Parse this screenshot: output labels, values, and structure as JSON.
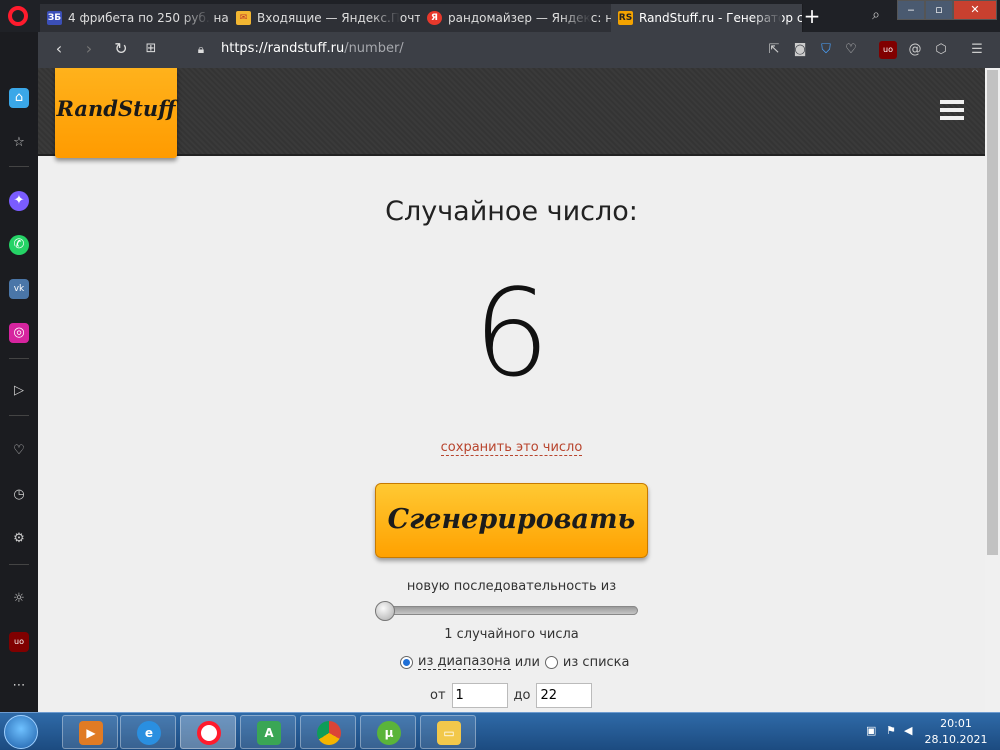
{
  "browser": {
    "tabs": [
      {
        "favicon": "ЗБ",
        "favicon_color": "#3b4fb8",
        "title": "4 фрибета по 250 руб. на"
      },
      {
        "favicon": "✉",
        "favicon_color": "#f2b632",
        "title": "Входящие — Яндекс.Почт"
      },
      {
        "favicon": "Я",
        "favicon_color": "#e8392c",
        "title": "рандомайзер — Яндекс: н"
      },
      {
        "favicon": "RS",
        "favicon_color": "#f4a300",
        "title": "RandStuff.ru - Генератор с"
      }
    ],
    "new_tab_label": "+",
    "url_host": "https://randstuff.ru",
    "url_path": "/number/"
  },
  "site": {
    "logo_text": "RandStuff",
    "heading": "Случайное число:",
    "number": "6",
    "save_link": "сохранить это число",
    "generate_label": "Сгенерировать",
    "sequence_label": "новую последовательность из",
    "count_label": "1 случайного числа",
    "slider_level": 0,
    "radio_range_label": "из диапазона",
    "radio_or": "или",
    "radio_list_label": "из списка",
    "from_label": "от",
    "from_value": "1",
    "to_label": "до",
    "to_value": "22"
  },
  "taskbar": {
    "time": "20:01",
    "date": "28.10.2021"
  },
  "colors": {
    "accent": "#ffa100",
    "link": "#b8442d",
    "tab_bg": "#2e3036"
  }
}
